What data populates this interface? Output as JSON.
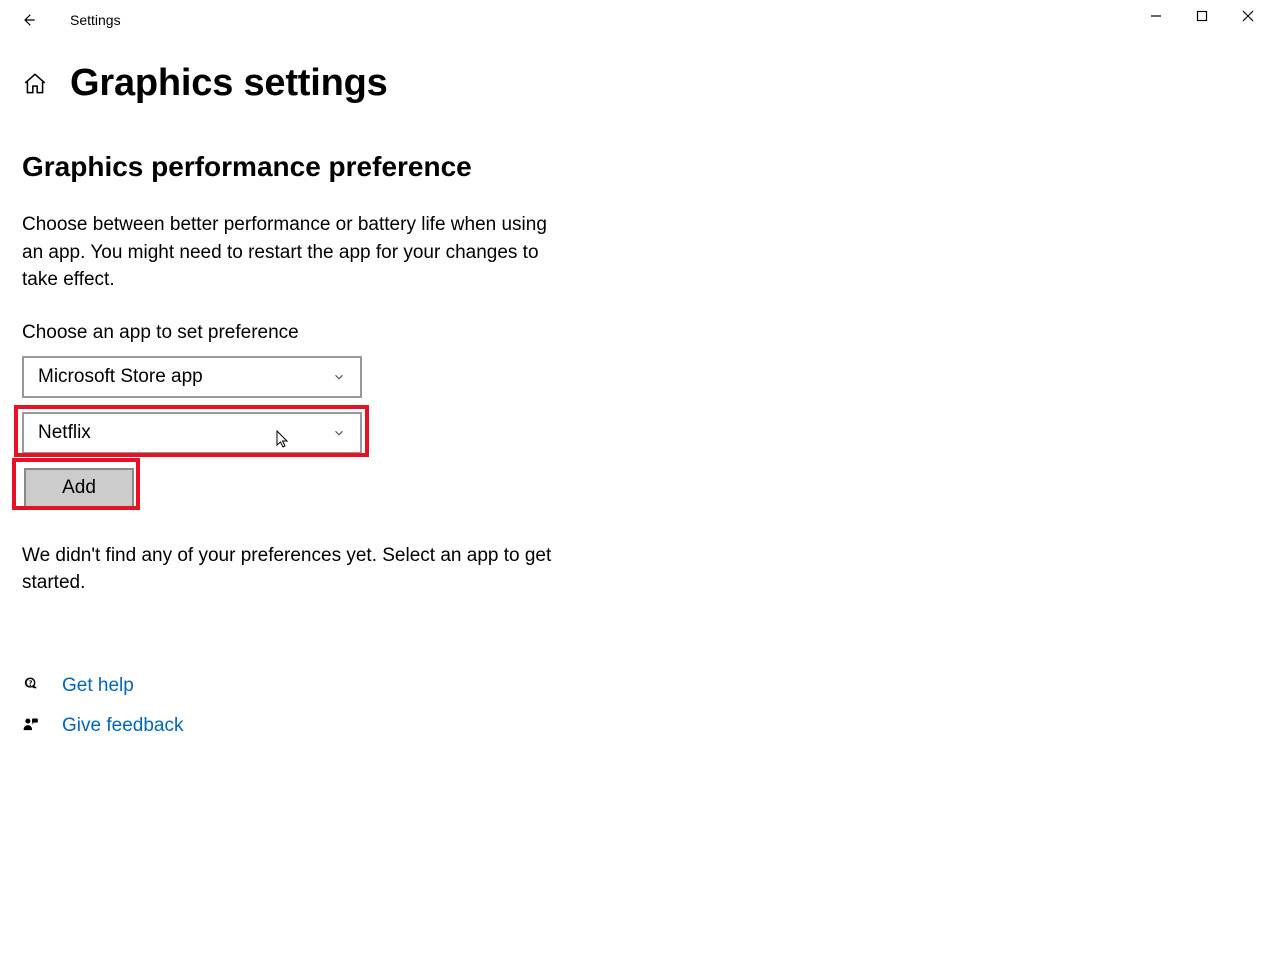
{
  "titlebar": {
    "title": "Settings"
  },
  "page": {
    "title": "Graphics settings",
    "section_title": "Graphics performance preference",
    "description": "Choose between better performance or battery life when using an app. You might need to restart the app for your changes to take effect.",
    "field_label": "Choose an app to set preference",
    "dropdown1": "Microsoft Store app",
    "dropdown2": "Netflix",
    "add_button": "Add",
    "info_text": "We didn't find any of your preferences yet. Select an app to get started.",
    "help_link": "Get help",
    "feedback_link": "Give feedback"
  }
}
